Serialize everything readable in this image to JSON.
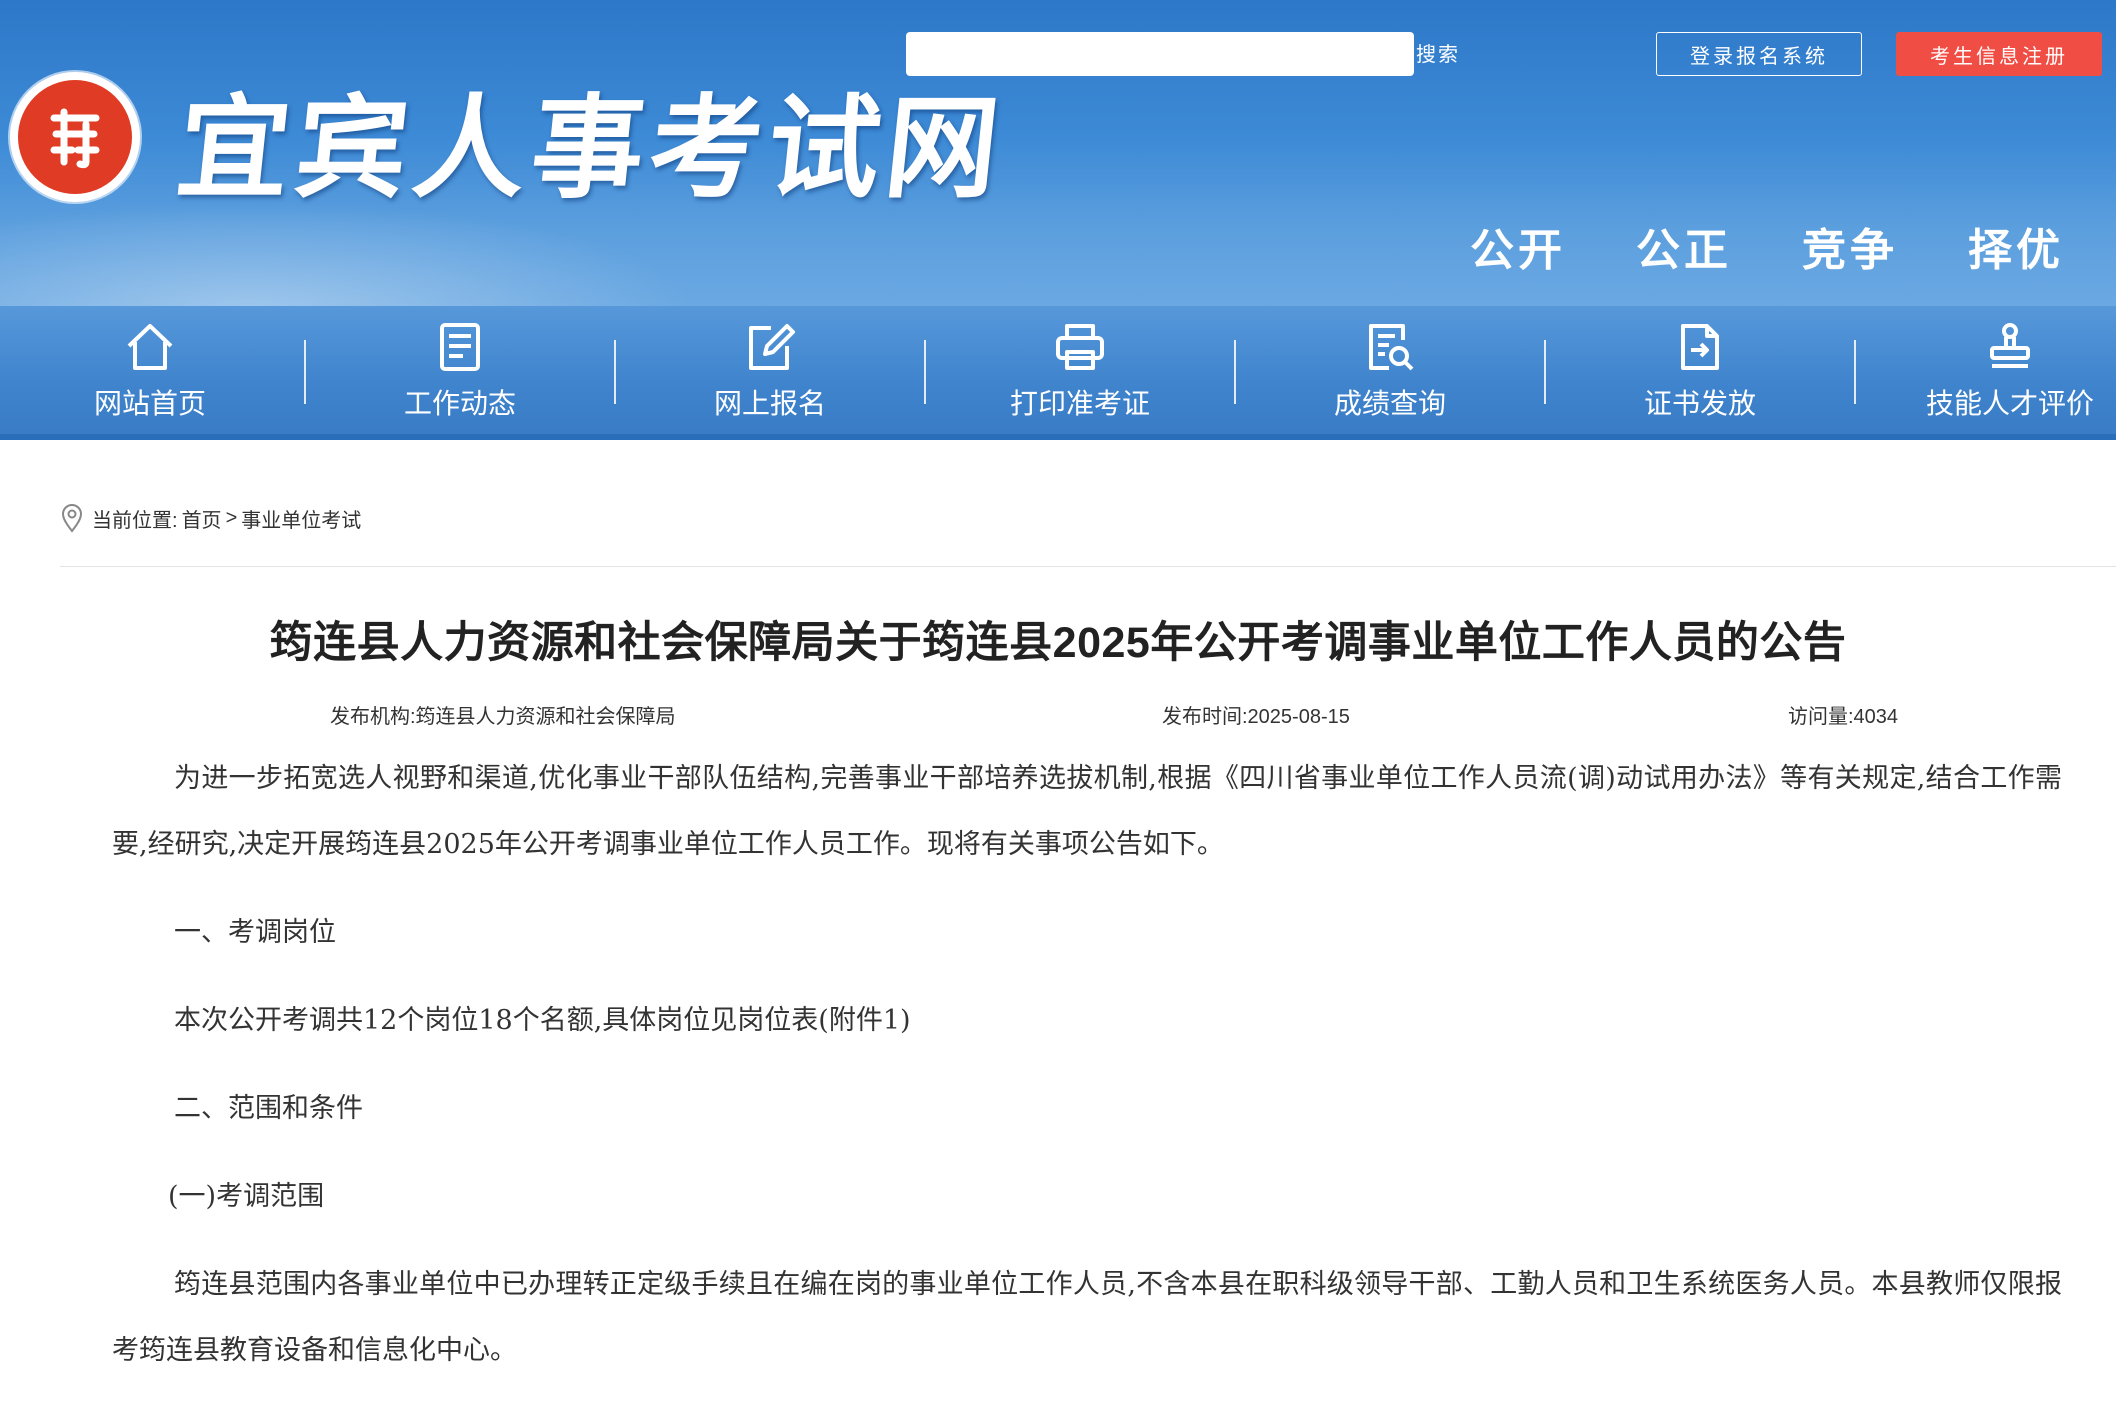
{
  "header": {
    "site_title": "宜宾人事考试网",
    "logo_icon": "red-seal-logo-icon",
    "search": {
      "placeholder": "",
      "value": "",
      "button": "搜索"
    },
    "login_button": "登录报名系统",
    "register_button": "考生信息注册",
    "slogans": [
      "公开",
      "公正",
      "竞争",
      "择优"
    ],
    "colors": {
      "header_blue": "#3d8ad6",
      "register_red": "#f04e45"
    }
  },
  "nav": {
    "items": [
      {
        "label": "网站首页",
        "icon": "home-icon"
      },
      {
        "label": "工作动态",
        "icon": "document-list-icon"
      },
      {
        "label": "网上报名",
        "icon": "edit-icon"
      },
      {
        "label": "打印准考证",
        "icon": "printer-icon"
      },
      {
        "label": "成绩查询",
        "icon": "search-document-icon"
      },
      {
        "label": "证书发放",
        "icon": "certificate-icon"
      },
      {
        "label": "技能人才评价",
        "icon": "stamp-icon"
      }
    ]
  },
  "breadcrumb": {
    "icon": "location-pin-icon",
    "prefix": "当前位置:",
    "home": "首页",
    "separator": ">",
    "current": "事业单位考试"
  },
  "article": {
    "title": "筠连县人力资源和社会保障局关于筠连县2025年公开考调事业单位工作人员的公告",
    "publisher": "发布机构:筠连县人力资源和社会保障局",
    "publish_time": "发布时间:2025-08-15",
    "views": "访问量:4034",
    "p1": "为进一步拓宽选人视野和渠道,优化事业干部队伍结构,完善事业干部培养选拔机制,根据《四川省事业单位工作人员流(调)动试用办法》等有关规定,结合工作需要,经研究,决定开展筠连县2025年公开考调事业单位工作人员工作。现将有关事项公告如下。",
    "h1": "一、考调岗位",
    "p2": "本次公开考调共12个岗位18个名额,具体岗位见岗位表(附件1)",
    "h2": "二、范围和条件",
    "h3": "(一)考调范围",
    "p3": "筠连县范围内各事业单位中已办理转正定级手续且在编在岗的事业单位工作人员,不含本县在职科级领导干部、工勤人员和卫生系统医务人员。本县教师仅限报考筠连县教育设备和信息化中心。"
  }
}
